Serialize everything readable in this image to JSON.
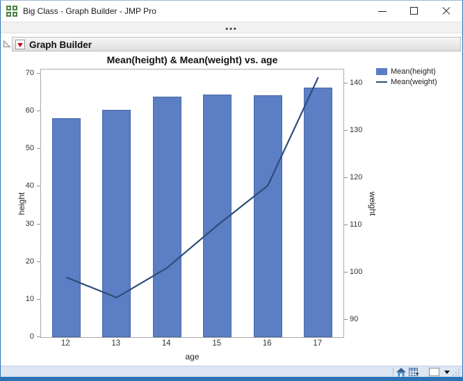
{
  "window": {
    "title": "Big Class - Graph Builder - JMP Pro"
  },
  "drag_handle": {
    "dots": "•••"
  },
  "panel": {
    "title": "Graph Builder"
  },
  "chart_data": {
    "type": "bar",
    "title": "Mean(height) & Mean(weight) vs. age",
    "categories": [
      "12",
      "13",
      "14",
      "15",
      "16",
      "17"
    ],
    "xlabel": "age",
    "series": [
      {
        "name": "Mean(height)",
        "kind": "bar",
        "axis": "left",
        "color": "#5b7ec4",
        "values": [
          58.1,
          60.4,
          63.9,
          64.5,
          64.3,
          66.4
        ]
      },
      {
        "name": "Mean(weight)",
        "kind": "line",
        "axis": "right",
        "color": "#2e4d7b",
        "values": [
          99,
          94.7,
          101,
          110,
          118.4,
          141.3
        ]
      }
    ],
    "left_axis": {
      "label": "height",
      "min": 0,
      "max": 70,
      "ticks": [
        0,
        10,
        20,
        30,
        40,
        50,
        60,
        70
      ]
    },
    "right_axis": {
      "label": "weight",
      "min": 88,
      "max": 141,
      "ticks": [
        90,
        100,
        110,
        120,
        130,
        140
      ]
    },
    "grid": false,
    "legend_position": "top-right"
  },
  "icons": {
    "app": "jmp-grid-icon",
    "disclosure": "disclosure-triangle-icon",
    "menu": "red-triangle-menu-icon",
    "status": [
      "home-icon",
      "data-table-icon",
      "color-swatch",
      "dropdown-arrow-icon",
      "resize-grip-icon"
    ]
  },
  "colors": {
    "accent_border": "#2d72b5",
    "bar_fill": "#5b7ec4",
    "line_stroke": "#2e4d7b",
    "status_bg": "#dce7f3"
  }
}
